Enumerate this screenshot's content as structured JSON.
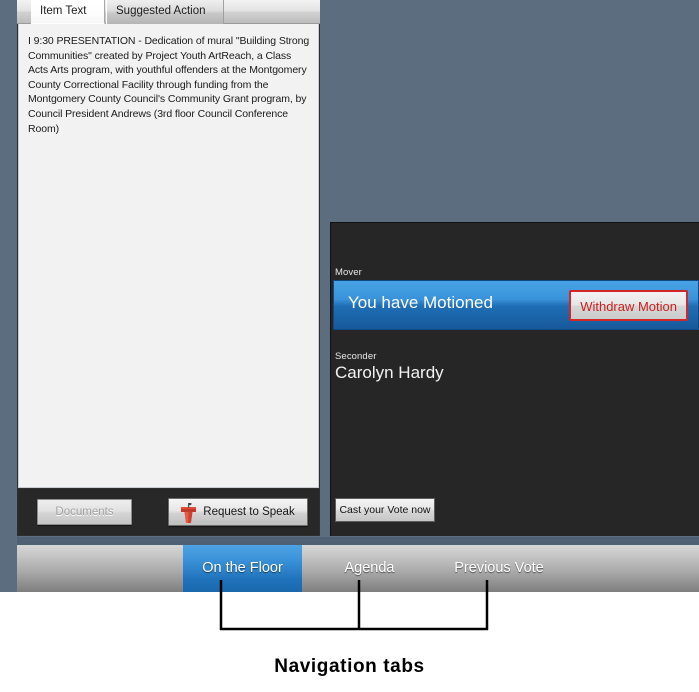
{
  "left_panel": {
    "tabs": [
      {
        "label": "Item Text",
        "active": true
      },
      {
        "label": "Suggested Action",
        "active": false
      }
    ],
    "item_text": "I       9:30       PRESENTATION - Dedication of mural \"Building Strong Communities\" created by Project Youth ArtReach, a Class Acts Arts program, with youthful offenders at the Montgomery County Correctional Facility through funding from the Montgomery County Council's Community Grant program, by Council President Andrews  (3rd floor Council Conference Room)",
    "buttons": {
      "documents": "Documents",
      "request_to_speak": "Request to Speak",
      "request_to_speak_icon": "podium-icon"
    }
  },
  "right_panel": {
    "mover_label": "Mover",
    "mover_status": "You have Motioned",
    "withdraw_button": "Withdraw Motion",
    "seconder_label": "Seconder",
    "seconder_name": "Carolyn Hardy",
    "cast_vote_button": "Cast your Vote now"
  },
  "nav_tabs": [
    {
      "label": "On the Floor",
      "selected": true
    },
    {
      "label": "Agenda",
      "selected": false
    },
    {
      "label": "Previous Vote",
      "selected": false
    }
  ],
  "annotation": {
    "caption": "Navigation tabs"
  },
  "colors": {
    "app_background": "#5d6d80",
    "dark_panel": "#262626",
    "accent_blue": "#1f72ba",
    "mover_blue_light": "#47a3e4",
    "withdraw_red": "#cc2020",
    "nav_selected_blue": "#3c93d9",
    "panel_light": "#f2f2f2"
  }
}
